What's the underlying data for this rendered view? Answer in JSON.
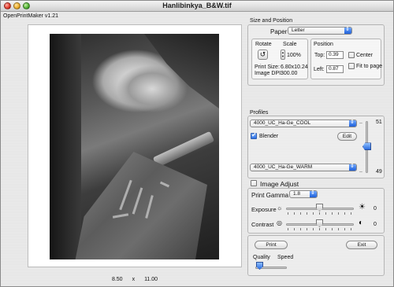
{
  "window": {
    "title": "Hanlibinkya_B&W.tif"
  },
  "app": {
    "version_label": "OpenPrintMaker v1.21"
  },
  "preview": {
    "width": "8.50",
    "sep": "x",
    "height": "11.00"
  },
  "size_position": {
    "group_label": "Size and Position",
    "paper_size_label": "Paper Size",
    "paper_size_value": "Letter",
    "rotate_label": "Rotate",
    "scale_label": "Scale",
    "scale_value": "100%",
    "print_size_label": "Print Size:",
    "print_size_value": "6.80x10.24",
    "image_dpi_label": "Image DPI:",
    "image_dpi_value": "300.00",
    "position_label": "Position",
    "top_label": "Top:",
    "top_value": "0.39",
    "left_label": "Left:",
    "left_value": "0.87",
    "center_label": "Center",
    "fit_label": "Fit to page"
  },
  "profiles": {
    "group_label": "Profiles",
    "profile_top": "4000_UC_Ha-Ge_COOL",
    "blender_label": "Blender",
    "edit_label": "Edit",
    "profile_bottom": "4000_UC_Ha-Ge_WARM",
    "blend_top_value": "51",
    "blend_bottom_value": "49",
    "blend_level": 0.51
  },
  "image_adjust": {
    "label": "Image Adjust",
    "print_gamma_label": "Print Gamma",
    "print_gamma_value": "1.8",
    "exposure_label": "Exposure",
    "exposure_value": "0",
    "contrast_label": "Contrast",
    "contrast_value": "0"
  },
  "actions": {
    "print_label": "Print",
    "exit_label": "Exit",
    "quality_label": "Quality",
    "speed_label": "Speed"
  },
  "colors": {
    "accent": "#2c6de0"
  }
}
